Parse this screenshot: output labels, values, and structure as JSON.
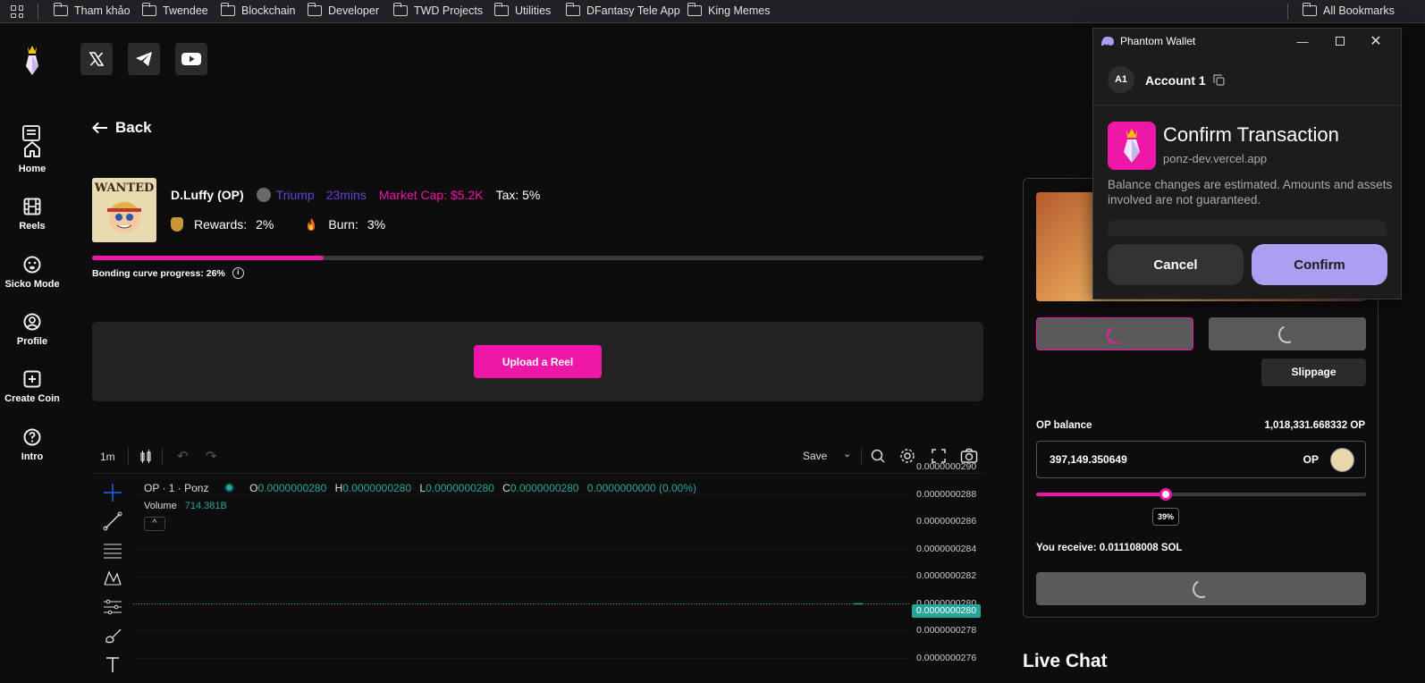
{
  "bookmarks": {
    "items": [
      "Tham khảo",
      "Twendee",
      "Blockchain",
      "Developer",
      "TWD Projects",
      "Utilities",
      "DFantasy Tele App",
      "King Memes"
    ],
    "all_label": "All Bookmarks"
  },
  "sidebar": {
    "items": [
      {
        "label": "Home",
        "icon": "home-icon"
      },
      {
        "label": "Reels",
        "icon": "film-icon"
      },
      {
        "label": "Sicko Mode",
        "icon": "face-icon"
      },
      {
        "label": "Profile",
        "icon": "user-circle-icon"
      },
      {
        "label": "Create Coin",
        "icon": "plus-square-icon"
      },
      {
        "label": "Intro",
        "icon": "help-icon"
      }
    ]
  },
  "back_label": "Back",
  "coin": {
    "name": "D.Luffy (OP)",
    "creator": "Triump",
    "age": "23mins",
    "market_cap": "Market Cap: $5.2K",
    "tax": "Tax: 5%",
    "rewards_label": "Rewards:",
    "rewards_value": "2%",
    "burn_label": "Burn:",
    "burn_value": "3%",
    "image_text": "WANTED",
    "bonding_label": "Bonding curve progress: 26%",
    "bonding_progress": 0.26
  },
  "upload_reel_label": "Upload a Reel",
  "chart_toolbar": {
    "interval": "1m",
    "save_label": "Save"
  },
  "chart_legend": {
    "symbol": "OP · 1 · Ponz",
    "o_label": "O",
    "o_value": "0.0000000280",
    "h_label": "H",
    "h_value": "0.0000000280",
    "l_label": "L",
    "l_value": "0.0000000280",
    "c_label": "C",
    "c_value": "0.0000000280",
    "change": "0.0000000000 (0.00%)",
    "volume_label": "Volume",
    "volume_value": "714.381B"
  },
  "chart_data": {
    "type": "line",
    "y_ticks": [
      "0.0000000290",
      "0.0000000288",
      "0.0000000286",
      "0.0000000284",
      "0.0000000282",
      "0.0000000280",
      "0.0000000278",
      "0.0000000276"
    ],
    "last_price": "0.0000000280",
    "ylim": [
      2.76e-08,
      2.9e-08
    ],
    "series": [
      {
        "values": [
          2.8e-08
        ]
      }
    ],
    "grid": true
  },
  "trade": {
    "slippage_label": "Slippage",
    "balance_label": "OP balance",
    "balance_value": "1,018,331.668332 OP",
    "amount_value": "397,149.350649",
    "token_label": "OP",
    "slider_percent": 39,
    "slider_label": "39%",
    "receive_label": "You receive: 0.011108008 SOL"
  },
  "live_chat_title": "Live Chat",
  "phantom": {
    "window_title": "Phantom Wallet",
    "account_avatar": "A1",
    "account_name": "Account 1",
    "title": "Confirm Transaction",
    "domain": "ponz-dev.vercel.app",
    "notice": "Balance changes are estimated. Amounts and assets involved are not guaranteed.",
    "cancel_label": "Cancel",
    "confirm_label": "Confirm"
  },
  "colors": {
    "accent": "#ee17a8",
    "creator": "#6b3fd6",
    "teal": "#26a69a",
    "confirm": "#ab9ff2"
  }
}
